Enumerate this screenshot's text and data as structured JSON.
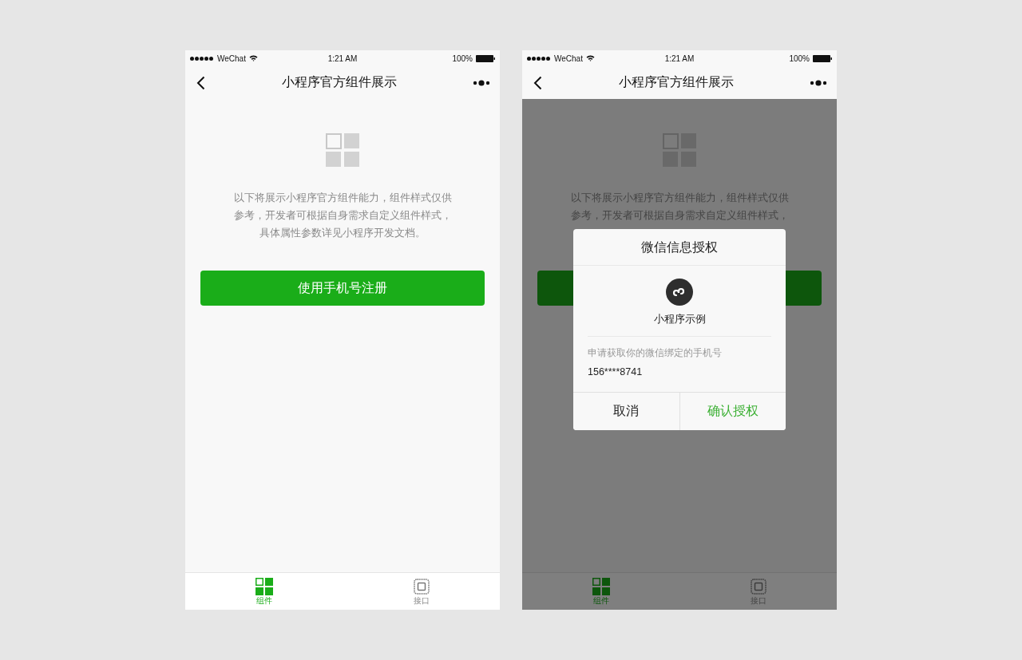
{
  "phones": [
    {
      "status_bar": {
        "carrier": "WeChat",
        "time": "1:21 AM",
        "battery": "100%"
      },
      "nav": {
        "title": "小程序官方组件展示"
      },
      "intro_lines": [
        "以下将展示小程序官方组件能力，组件样式仅供",
        "参考，开发者可根据自身需求自定义组件样式，",
        "具体属性参数详见小程序开发文档。"
      ],
      "primary_button": "使用手机号注册",
      "tabs": [
        {
          "label": "组件",
          "kind": "grid",
          "selected": true
        },
        {
          "label": "接口",
          "kind": "chip",
          "selected": false
        }
      ]
    },
    {
      "status_bar": {
        "carrier": "WeChat",
        "time": "1:21 AM",
        "battery": "100%"
      },
      "nav": {
        "title": "小程序官方组件展示"
      },
      "intro_lines": [
        "以下将展示小程序官方组件能力，组件样式仅供",
        "参考，开发者可根据自身需求自定义组件样式，"
      ],
      "tabs": [
        {
          "label": "组件",
          "kind": "grid",
          "selected": true
        },
        {
          "label": "接口",
          "kind": "chip",
          "selected": false
        }
      ],
      "dialog": {
        "title": "微信信息授权",
        "app_name": "小程序示例",
        "request": "申请获取你的微信绑定的手机号",
        "phone": "156****8741",
        "cancel": "取消",
        "confirm": "确认授权"
      }
    }
  ]
}
